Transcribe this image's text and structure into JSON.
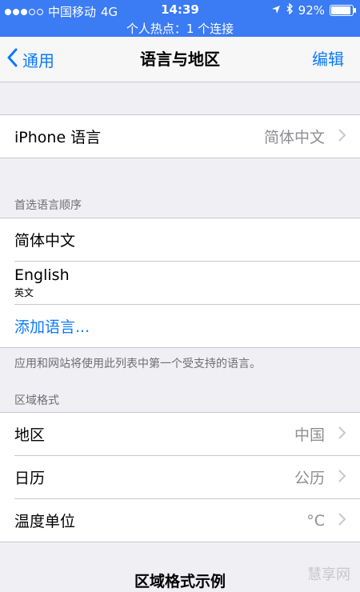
{
  "status_bar": {
    "carrier": "中国移动",
    "network": "4G",
    "time": "14:39",
    "battery": "92%",
    "battery_fraction": 0.92
  },
  "hotspot_text": "个人热点：1 个连接",
  "nav": {
    "back_label": "通用",
    "title": "语言与地区",
    "edit_label": "编辑"
  },
  "iphone_language": {
    "label": "iPhone 语言",
    "value": "简体中文"
  },
  "preferred_order": {
    "header": "首选语言顺序",
    "items": [
      {
        "label": "简体中文"
      },
      {
        "label": "English",
        "sub": "英文"
      }
    ],
    "add_label": "添加语言...",
    "footer": "应用和网站将使用此列表中第一个受支持的语言。"
  },
  "region_format": {
    "header": "区域格式",
    "rows": [
      {
        "label": "地区",
        "value": "中国"
      },
      {
        "label": "日历",
        "value": "公历"
      },
      {
        "label": "温度单位",
        "value": "°C"
      }
    ]
  },
  "example_title": "区域格式示例",
  "watermark": "慧享网",
  "colors": {
    "accent": "#0a7aff",
    "status_bar": "#3b7bf4",
    "background": "#efeff4"
  }
}
